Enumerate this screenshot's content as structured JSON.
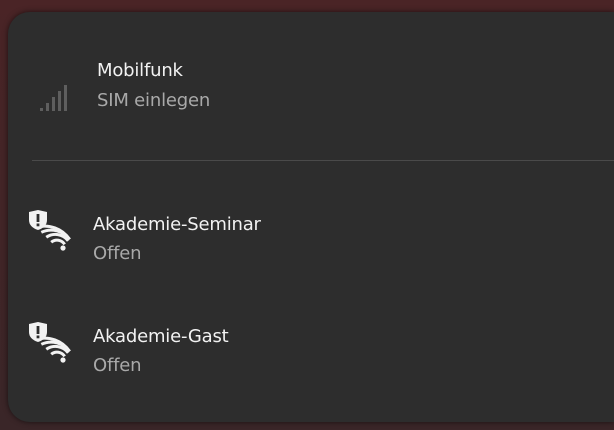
{
  "flyout": {
    "cellular": {
      "title": "Mobilfunk",
      "status": "SIM einlegen",
      "icon": "cellular-signal-icon"
    },
    "networks": [
      {
        "name": "Akademie-Seminar",
        "status": "Offen",
        "icon": "wifi-unsecured-icon"
      },
      {
        "name": "Akademie-Gast",
        "status": "Offen",
        "icon": "wifi-unsecured-icon"
      }
    ]
  },
  "colors": {
    "panel_background": "#2d2d2d",
    "title_text": "#f2f2f2",
    "subtitle_text": "#a9a9a9",
    "divider": "#4a4a4a",
    "icon_dim": "#5e5e5e",
    "icon_bright": "#f2f2f2"
  }
}
